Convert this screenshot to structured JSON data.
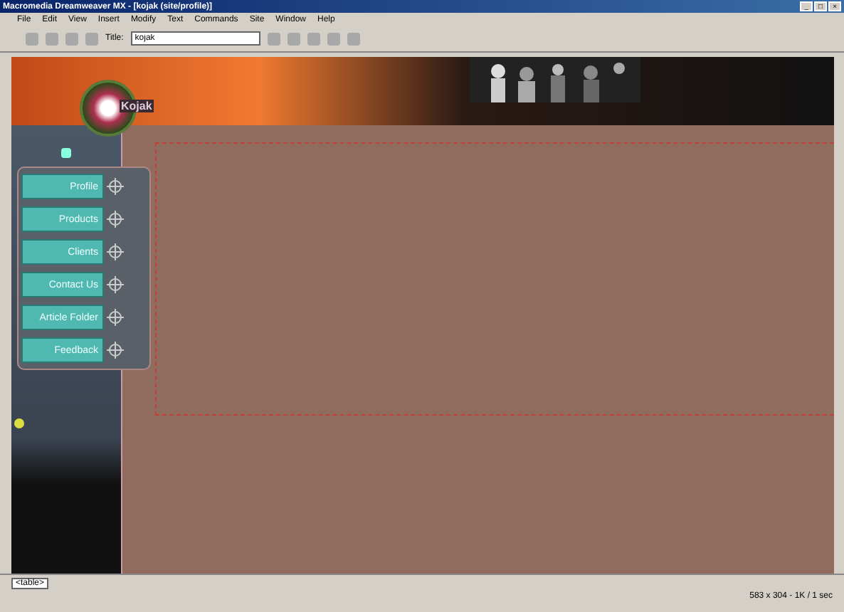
{
  "window": {
    "title": "Macromedia Dreamweaver MX - [kojak (site/profile)]",
    "controls": [
      "_",
      "□",
      "×"
    ]
  },
  "menu": [
    "File",
    "Edit",
    "View",
    "Insert",
    "Modify",
    "Text",
    "Commands",
    "Site",
    "Window",
    "Help"
  ],
  "toolbar": {
    "title_label": "Title:",
    "title_value": "kojak"
  },
  "site": {
    "logo": "Kojak",
    "nav": [
      {
        "label": "Profile"
      },
      {
        "label": "Products"
      },
      {
        "label": "Clients"
      },
      {
        "label": "Contact Us"
      },
      {
        "label": "Article Folder"
      },
      {
        "label": "Feedback"
      }
    ]
  },
  "status_bar": {
    "tag": "<table>",
    "right": "583 x 304 - 1K / 1 sec"
  }
}
